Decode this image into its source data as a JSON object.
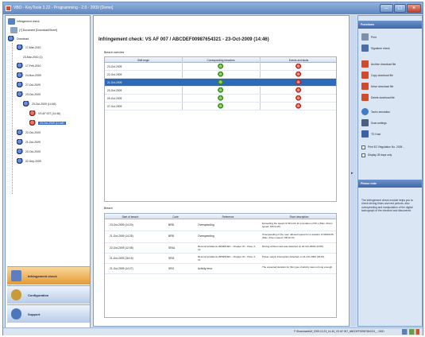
{
  "window": {
    "title": "VBO - KeyTools 3.22 - Programming - 2.0 - 2009 [Demo]"
  },
  "tree": {
    "root_label": "Infringement check",
    "card_label": "[?] Document [Download\\Sheet]",
    "vehicle_label": "Download",
    "dates": [
      "17-Mar-2010",
      "23-Mar-2010 (1)",
      "17-Feb-2010",
      "24-Nov-2009",
      "27-Oct-2009",
      "23-Oct-2009",
      "23-Oct-2009 (14:46)",
      "VS AF 007 (14:46)",
      "23-Oct-2009 (14:46)",
      "22-Oct-2009",
      "21-Oct-2009",
      "20-Oct-2009",
      "02-Sep-2009"
    ]
  },
  "nav": [
    {
      "label": "Infringement check",
      "icon": "infringement-icon"
    },
    {
      "label": "Configuration",
      "icon": "configuration-icon"
    },
    {
      "label": "Support",
      "icon": "support-icon"
    }
  ],
  "main": {
    "title": "Infringement check: VS AF 007 / ABCDEF009876543​21  -  23-Oct-2009 (14:46)",
    "overview_label": "Breach overview",
    "overview_headers": [
      "Shift begin",
      "Corresponding breaches",
      "Events and faults"
    ],
    "overview_rows": [
      {
        "date": "23-Oct-2009",
        "breach": "green",
        "fault": "red",
        "selected": false
      },
      {
        "date": "22-Oct-2009",
        "breach": "green",
        "fault": "red",
        "selected": false
      },
      {
        "date": "21-Oct-2009",
        "breach": "green",
        "fault": "red",
        "selected": true
      },
      {
        "date": "20-Oct-2009",
        "breach": "green",
        "fault": "red",
        "selected": false
      },
      {
        "date": "09-Oct-2009",
        "breach": "green",
        "fault": "red",
        "selected": false
      },
      {
        "date": "07-Oct-2009",
        "breach": "green",
        "fault": "red",
        "selected": false
      }
    ],
    "details_label": "Breach",
    "details_headers": [
      "Start of breach",
      "Code",
      "Reference",
      "Short description"
    ],
    "details_rows": [
      {
        "start": "23-Oct-2009 (14:20)",
        "code": "BRB",
        "reference": "Overspeeding",
        "description": "Exceeding the speed of 90 km/h for a duration of 60 s (Max. driven speed: 106 km/h)"
      },
      {
        "start": "21-Oct-2009 (14:28)",
        "code": "BRB",
        "reference": "Overspeeding",
        "description": "Overspeeding of the max. allowed speed for a duration of 99401/25. (Max. driven speed: 106 km/h)"
      },
      {
        "start": "22-Oct-2009 (12:08)",
        "code": "SRAL",
        "reference": "Recommendations 2009/61/EC - Chapter 2C - Para. 2, 12",
        "description": "Driving without card was detected on 22-Oct-2009 (13:05)."
      },
      {
        "start": "21-Oct-2009 (18:16)",
        "code": "SRI2",
        "reference": "Recommendations 2009/61/EC - Chapter 2C - Para. 2, 12",
        "description": "Power supply interruption detected on 21-Oct-2009 (18:16)."
      },
      {
        "start": "21-Oct-2009 (14:27)",
        "code": "SRO",
        "reference": "Activity error",
        "description": "The expected duration for this type of activity was not long enough."
      }
    ]
  },
  "functions": {
    "header": "Functions",
    "items": [
      {
        "label": "Print",
        "icon": "print-icon"
      },
      {
        "label": "Signature check",
        "icon": "signature-icon"
      },
      {
        "label": "Archive download file",
        "icon": "archive-icon"
      },
      {
        "label": "Copy download file",
        "icon": "copy-file-icon"
      },
      {
        "label": "Move download file",
        "icon": "move-file-icon"
      },
      {
        "label": "Delete download file",
        "icon": "delete-file-icon"
      },
      {
        "label": "Tacho emulation",
        "icon": "tacho-icon"
      },
      {
        "label": "Scan settings",
        "icon": "scan-icon"
      },
      {
        "label": "TD Host",
        "icon": "host-icon"
      }
    ],
    "options": [
      {
        "label": "Print EC Regulation No. 2009...",
        "checked": true
      },
      {
        "label": "Display 28 days only",
        "checked": true
      }
    ]
  },
  "note": {
    "header": "Please note",
    "text": "The Infringement check module helps you to check driving times and rest periods, also overspeeding and manipulation of the digital tachograph of the checked and discovered."
  },
  "status": {
    "path": "F:\\Downloads\\M_2009-10-23_14-46_VS AF 007_ABCDEF00987654321_...DDD"
  },
  "colors": {
    "accent": "#3b6fc2",
    "active_nav": "#e59a33"
  }
}
